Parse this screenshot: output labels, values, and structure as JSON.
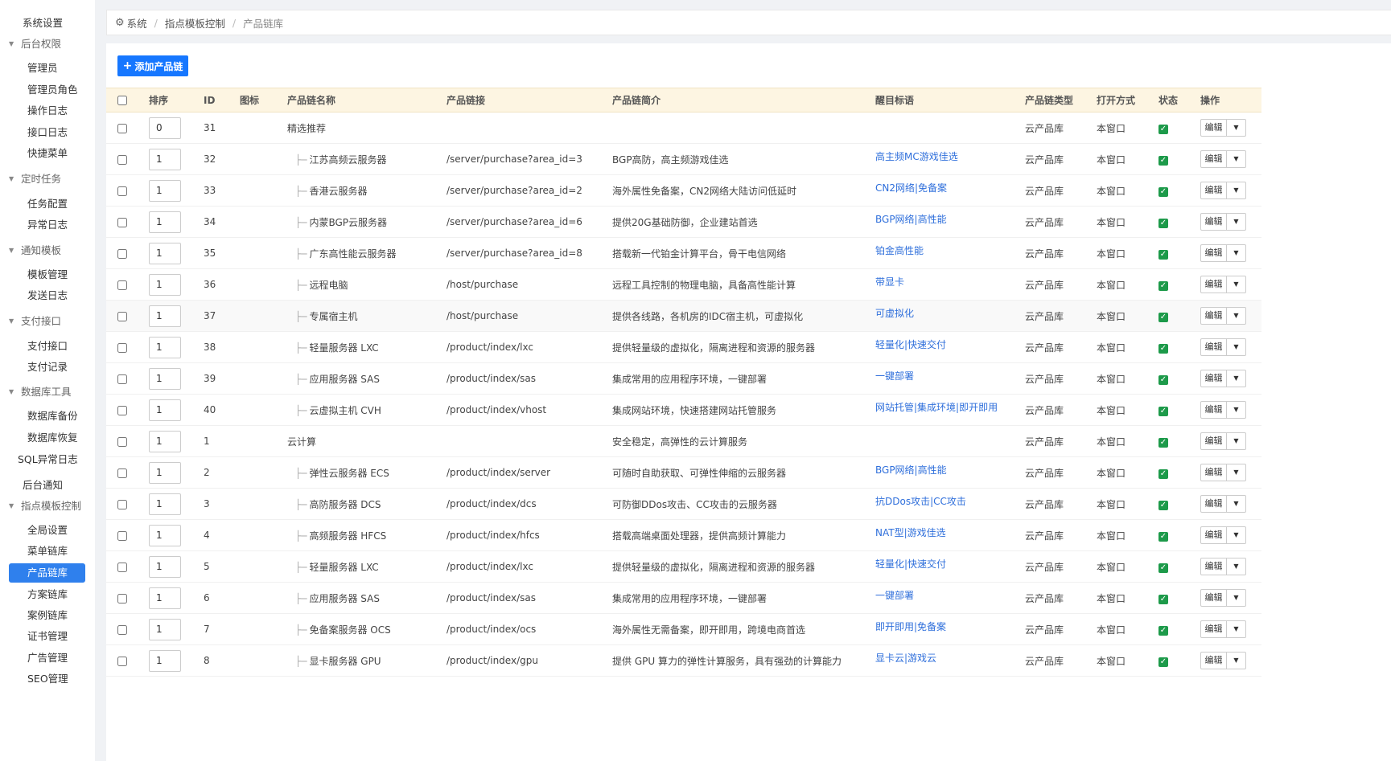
{
  "sidebar": {
    "top_item": "系统设置",
    "groups": [
      {
        "label": "后台权限",
        "items": [
          "管理员",
          "管理员角色",
          "操作日志",
          "接口日志",
          "快捷菜单"
        ]
      },
      {
        "label": "定时任务",
        "items": [
          "任务配置",
          "异常日志"
        ]
      },
      {
        "label": "通知模板",
        "items": [
          "模板管理",
          "发送日志"
        ]
      },
      {
        "label": "支付接口",
        "items": [
          "支付接口",
          "支付记录"
        ]
      },
      {
        "label": "数据库工具",
        "items": [
          "数据库备份",
          "数据库恢复",
          "SQL异常日志"
        ]
      },
      {
        "label": "指点模板控制",
        "items": [
          "全局设置",
          "菜单链库",
          "产品链库",
          "方案链库",
          "案例链库",
          "证书管理",
          "广告管理",
          "SEO管理"
        ]
      }
    ],
    "standalone": "后台通知",
    "active": "产品链库"
  },
  "breadcrumb": {
    "home": "系统",
    "parent": "指点模板控制",
    "current": "产品链库",
    "sep": "/"
  },
  "toolbar": {
    "add_label": "添加产品链"
  },
  "table": {
    "headers": [
      "排序",
      "ID",
      "图标",
      "产品链名称",
      "产品链接",
      "产品链简介",
      "醒目标语",
      "产品链类型",
      "打开方式",
      "状态",
      "操作"
    ],
    "edit_label": "编辑",
    "rows": [
      {
        "sort": "0",
        "id": "31",
        "name": "精选推荐",
        "child": false,
        "link": "",
        "desc": "",
        "slogan": "",
        "type": "云产品库",
        "open": "本窗口"
      },
      {
        "sort": "1",
        "id": "32",
        "name": "江苏高频云服务器",
        "child": true,
        "link": "/server/purchase?area_id=3",
        "desc": "BGP高防，高主频游戏佳选",
        "slogan": "高主频MC游戏佳选",
        "type": "云产品库",
        "open": "本窗口"
      },
      {
        "sort": "1",
        "id": "33",
        "name": "香港云服务器",
        "child": true,
        "link": "/server/purchase?area_id=2",
        "desc": "海外属性免备案，CN2网络大陆访问低延时",
        "slogan": "CN2网络|免备案",
        "type": "云产品库",
        "open": "本窗口"
      },
      {
        "sort": "1",
        "id": "34",
        "name": "内蒙BGP云服务器",
        "child": true,
        "link": "/server/purchase?area_id=6",
        "desc": "提供20G基础防御，企业建站首选",
        "slogan": "BGP网络|高性能",
        "type": "云产品库",
        "open": "本窗口"
      },
      {
        "sort": "1",
        "id": "35",
        "name": "广东高性能云服务器",
        "child": true,
        "link": "/server/purchase?area_id=8",
        "desc": "搭载新一代铂金计算平台，骨干电信网络",
        "slogan": "铂金高性能",
        "type": "云产品库",
        "open": "本窗口"
      },
      {
        "sort": "1",
        "id": "36",
        "name": "远程电脑",
        "child": true,
        "link": "/host/purchase",
        "desc": "远程工具控制的物理电脑，具备高性能计算",
        "slogan": "带显卡",
        "type": "云产品库",
        "open": "本窗口"
      },
      {
        "sort": "1",
        "id": "37",
        "name": "专属宿主机",
        "child": true,
        "link": "/host/purchase",
        "desc": "提供各线路，各机房的IDC宿主机，可虚拟化",
        "slogan": "可虚拟化",
        "type": "云产品库",
        "open": "本窗口"
      },
      {
        "sort": "1",
        "id": "38",
        "name": "轻量服务器 LXC",
        "child": true,
        "link": "/product/index/lxc",
        "desc": "提供轻量级的虚拟化，隔离进程和资源的服务器",
        "slogan": "轻量化|快速交付",
        "type": "云产品库",
        "open": "本窗口"
      },
      {
        "sort": "1",
        "id": "39",
        "name": "应用服务器 SAS",
        "child": true,
        "link": "/product/index/sas",
        "desc": "集成常用的应用程序环境，一键部署",
        "slogan": "一键部署",
        "type": "云产品库",
        "open": "本窗口"
      },
      {
        "sort": "1",
        "id": "40",
        "name": "云虚拟主机 CVH",
        "child": true,
        "link": "/product/index/vhost",
        "desc": "集成网站环境，快速搭建网站托管服务",
        "slogan": "网站托管|集成环境|即开即用",
        "type": "云产品库",
        "open": "本窗口"
      },
      {
        "sort": "1",
        "id": "1",
        "name": "云计算",
        "child": false,
        "link": "",
        "desc": "安全稳定，高弹性的云计算服务",
        "slogan": "",
        "type": "云产品库",
        "open": "本窗口"
      },
      {
        "sort": "1",
        "id": "2",
        "name": "弹性云服务器 ECS",
        "child": true,
        "link": "/product/index/server",
        "desc": "可随时自助获取、可弹性伸缩的云服务器",
        "slogan": "BGP网络|高性能",
        "type": "云产品库",
        "open": "本窗口"
      },
      {
        "sort": "1",
        "id": "3",
        "name": "高防服务器 DCS",
        "child": true,
        "link": "/product/index/dcs",
        "desc": "可防御DDos攻击、CC攻击的云服务器",
        "slogan": "抗DDos攻击|CC攻击",
        "type": "云产品库",
        "open": "本窗口"
      },
      {
        "sort": "1",
        "id": "4",
        "name": "高频服务器 HFCS",
        "child": true,
        "link": "/product/index/hfcs",
        "desc": "搭载高端桌面处理器，提供高频计算能力",
        "slogan": "NAT型|游戏佳选",
        "type": "云产品库",
        "open": "本窗口"
      },
      {
        "sort": "1",
        "id": "5",
        "name": "轻量服务器 LXC",
        "child": true,
        "link": "/product/index/lxc",
        "desc": "提供轻量级的虚拟化，隔离进程和资源的服务器",
        "slogan": "轻量化|快速交付",
        "type": "云产品库",
        "open": "本窗口"
      },
      {
        "sort": "1",
        "id": "6",
        "name": "应用服务器 SAS",
        "child": true,
        "link": "/product/index/sas",
        "desc": "集成常用的应用程序环境，一键部署",
        "slogan": "一键部署",
        "type": "云产品库",
        "open": "本窗口"
      },
      {
        "sort": "1",
        "id": "7",
        "name": "免备案服务器 OCS",
        "child": true,
        "link": "/product/index/ocs",
        "desc": "海外属性无需备案，即开即用，跨境电商首选",
        "slogan": "即开即用|免备案",
        "type": "云产品库",
        "open": "本窗口"
      },
      {
        "sort": "1",
        "id": "8",
        "name": "显卡服务器 GPU",
        "child": true,
        "link": "/product/index/gpu",
        "desc": "提供 GPU 算力的弹性计算服务，具有强劲的计算能力",
        "slogan": "显卡云|游戏云",
        "type": "云产品库",
        "open": "本窗口"
      }
    ]
  }
}
